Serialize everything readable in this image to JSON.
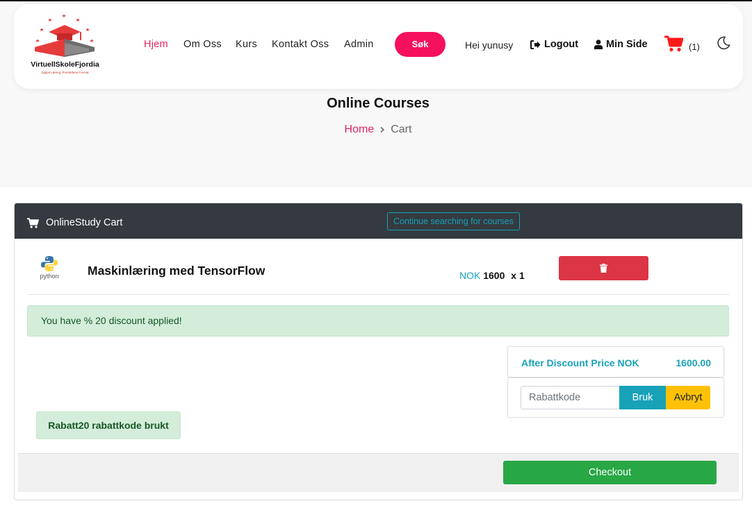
{
  "brand": {
    "name": "VirtuellSkoleFjordia",
    "tagline": "Digital Læring, Fremtidens Format"
  },
  "nav": {
    "items": [
      {
        "label": "Hjem",
        "active": true
      },
      {
        "label": "Om Oss"
      },
      {
        "label": "Kurs"
      },
      {
        "label": "Kontakt Oss"
      },
      {
        "label": "Admin"
      }
    ],
    "search_label": "Søk",
    "greeting": "Hei yunusy",
    "logout_label": "Logout",
    "minside_label": "Min Side",
    "cart_count": "(1)"
  },
  "page": {
    "title": "Online Courses",
    "breadcrumb": {
      "home": "Home",
      "current": "Cart"
    }
  },
  "cart": {
    "title": "OnlineStudy Cart",
    "continue_label": "Continue searching for courses",
    "item": {
      "logo_text": "python",
      "name": "Maskinlæring med TensorFlow",
      "currency": "NOK",
      "price": "1600",
      "qty": "x 1"
    },
    "discount_alert": "You have % 20 discount applied!",
    "after_discount_label": "After Discount Price NOK",
    "after_discount_value": "1600.00",
    "coupon_placeholder": "Rabattkode",
    "apply_label": "Bruk",
    "cancel_label": "Avbryt",
    "coupon_used": "Rabatt20 rabattkode brukt",
    "checkout_label": "Checkout"
  },
  "colors": {
    "accent": "#f5115d",
    "active_nav": "#e0245e",
    "info": "#17a2b8",
    "danger": "#dc3545",
    "success": "#28a745",
    "warning": "#ffc107",
    "header_dark": "#343a40"
  },
  "icons": [
    "graduation-cap-logo",
    "logout-icon",
    "user-icon",
    "cart-icon",
    "moon-icon",
    "trash-icon",
    "python-logo",
    "chevron-right-icon"
  ]
}
